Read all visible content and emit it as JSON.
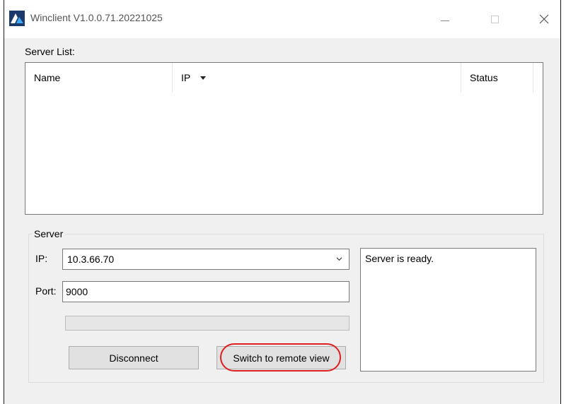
{
  "window": {
    "title": "Winclient V1.0.0.71.20221025",
    "icon": "winclient-app-icon",
    "controls": [
      "minimize-icon",
      "maximize-icon",
      "close-icon"
    ]
  },
  "server_list": {
    "label": "Server List:",
    "columns": [
      "Name",
      "IP",
      "Status"
    ],
    "sorted_column": "IP",
    "rows": []
  },
  "server_group": {
    "legend": "Server",
    "ip_label": "IP:",
    "ip_value": "10.3.66.70",
    "port_label": "Port:",
    "port_value": "9000",
    "progress_fraction": 0,
    "disconnect_label": "Disconnect",
    "switch_label": "Switch to remote view",
    "status_text": "Server is ready."
  },
  "colors": {
    "highlight": "#e01e1e",
    "window_bg": "#f0f0f0"
  }
}
